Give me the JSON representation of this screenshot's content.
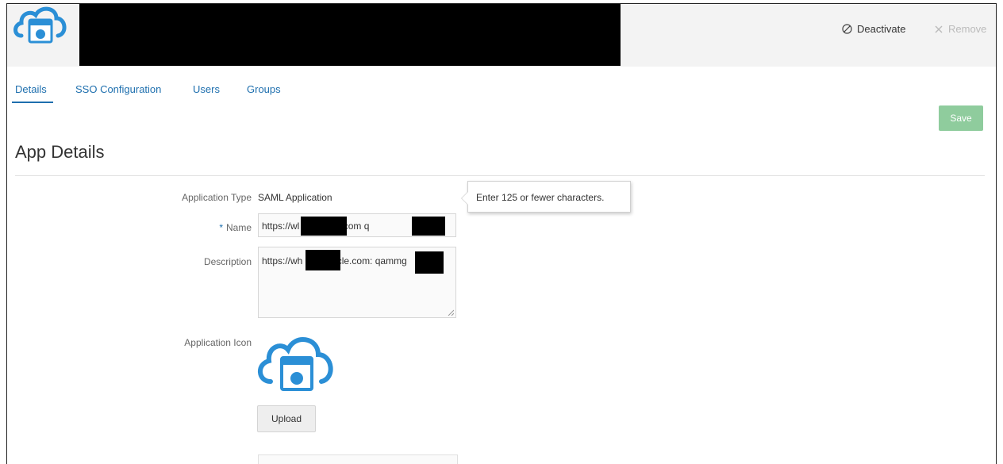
{
  "header": {
    "deactivate_label": "Deactivate",
    "remove_label": "Remove",
    "deactivate_icon": "ban-icon",
    "remove_icon": "close-icon"
  },
  "tabs": [
    {
      "label": "Details",
      "active": true
    },
    {
      "label": "SSO Configuration",
      "active": false
    },
    {
      "label": "Users",
      "active": false
    },
    {
      "label": "Groups",
      "active": false
    }
  ],
  "toolbar": {
    "save_label": "Save"
  },
  "page": {
    "title": "App Details"
  },
  "form": {
    "app_type_label": "Application Type",
    "app_type_value": "SAML Application",
    "name_label": "Name",
    "name_required_marker": "*",
    "name_value": "https://wl         .in.oracle.com        q",
    "description_label": "Description",
    "description_value": "https://wh         o.in.oracle.com:        qammg",
    "icon_label": "Application Icon",
    "upload_label": "Upload"
  },
  "tooltip": {
    "text": "Enter 125 or fewer characters."
  },
  "colors": {
    "accent": "#1e6fae",
    "icon_blue": "#2b8fd6",
    "save_disabled": "#8fcc9d"
  }
}
